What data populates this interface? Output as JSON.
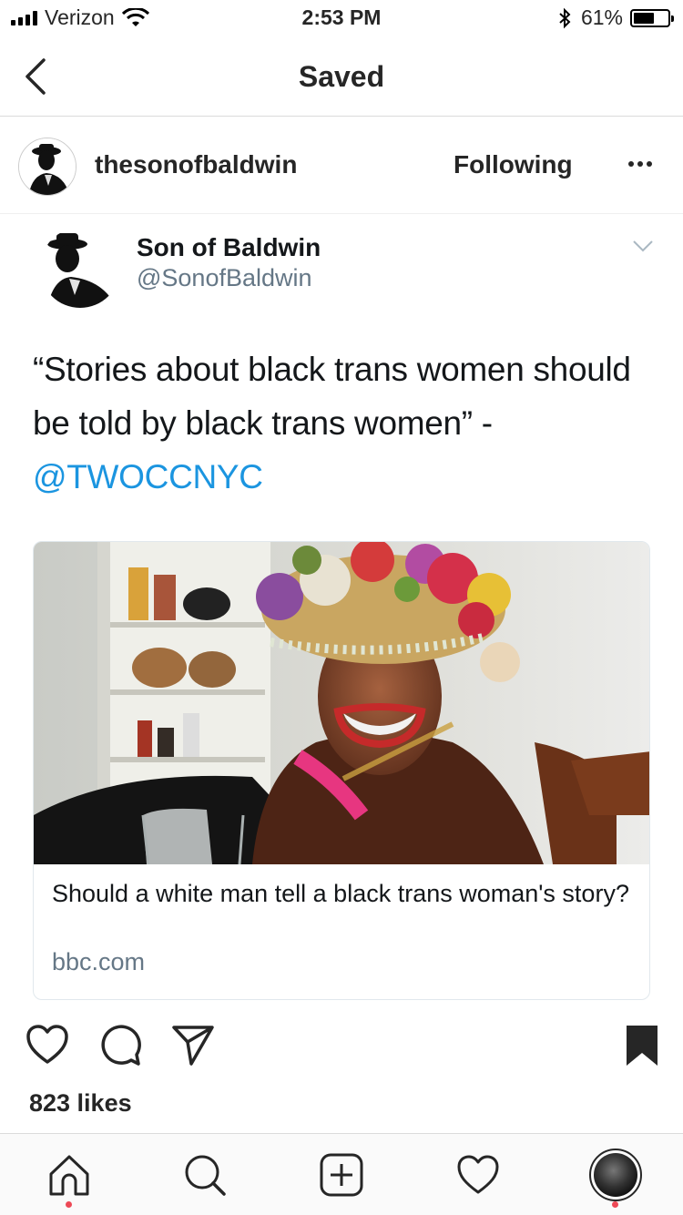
{
  "status_bar": {
    "carrier": "Verizon",
    "time": "2:53 PM",
    "battery_percent": "61%",
    "battery_level": 0.61
  },
  "nav": {
    "title": "Saved",
    "back_icon": "chevron-left-icon"
  },
  "post": {
    "username": "thesonofbaldwin",
    "follow_label": "Following",
    "more_icon": "more-dots-icon"
  },
  "tweet": {
    "display_name": "Son of Baldwin",
    "handle": "@SonofBaldwin",
    "text": "“Stories about black trans women should be told by black trans women” - ",
    "mention": "@TWOCCNYC",
    "card": {
      "title": "Should a white man tell a black trans woman's story?",
      "domain": "bbc.com"
    }
  },
  "actions": {
    "like_icon": "heart-icon",
    "comment_icon": "comment-icon",
    "share_icon": "paper-plane-icon",
    "save_icon": "bookmark-icon",
    "likes": "823 likes"
  },
  "tabbar": {
    "items": [
      "home-icon",
      "search-icon",
      "add-icon",
      "heart-icon",
      "profile-avatar"
    ],
    "notification_color": "#ed4956"
  },
  "colors": {
    "link": "#1b95e0",
    "muted": "#657786",
    "text": "#262626"
  }
}
